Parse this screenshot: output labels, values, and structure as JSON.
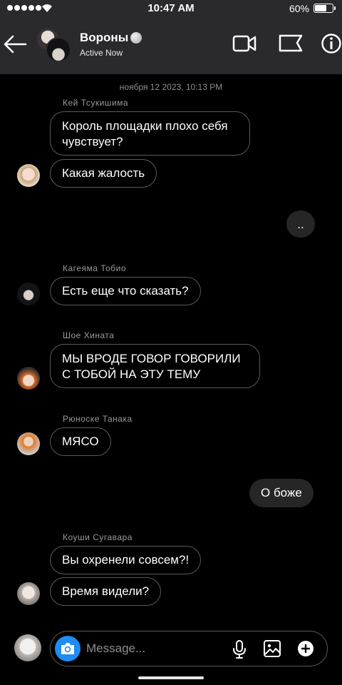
{
  "status_bar": {
    "time": "10:47 AM",
    "battery_percent": "60%",
    "battery_level": 0.6,
    "icons": [
      "signal-dots-icon",
      "wifi-icon",
      "battery-icon"
    ]
  },
  "header": {
    "title": "Вороны",
    "status": "Active Now",
    "icons": [
      "back-arrow-icon",
      "video-call-icon",
      "flag-icon",
      "info-icon"
    ]
  },
  "chat": {
    "date": "ноября 12 2023, 10:13 PM",
    "messages": [
      {
        "sender": "Кей Тсукишима",
        "texts": [
          "Король площадки плохо себя\nчувствует?",
          "Какая жалость"
        ]
      },
      {
        "outgoing": true,
        "text": ".."
      },
      {
        "sender": "Кагеяма Тобио",
        "texts": [
          "Есть еще что сказать?"
        ]
      },
      {
        "sender": "Шое Хината",
        "texts": [
          "МЫ ВРОДЕ ГОВОР ГОВОРИЛИ\nС ТОБОЙ НА ЭТУ ТЕМУ"
        ]
      },
      {
        "sender": "Рюноске Танака",
        "texts": [
          "МЯСО"
        ]
      },
      {
        "outgoing": true,
        "text": "О боже"
      },
      {
        "sender": "Коуши Сугавара",
        "texts": [
          "Вы охренели совсем?!",
          "Время видели?"
        ]
      }
    ]
  },
  "composer": {
    "placeholder": "Message...",
    "icons": [
      "camera-icon",
      "microphone-icon",
      "gallery-icon",
      "add-icon"
    ]
  },
  "colors": {
    "background": "#000000",
    "bar": "#2a2a2c",
    "bubble_border": "#5a5a5a",
    "outgoing_bubble": "#262626",
    "camera_button": "#1f8cf0"
  }
}
